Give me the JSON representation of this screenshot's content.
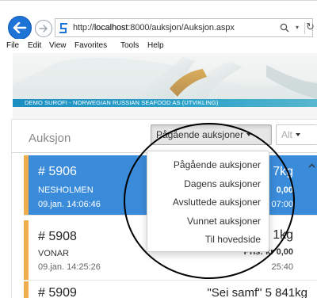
{
  "browser": {
    "url_prefix": "http://",
    "url_host": "localhost",
    "url_rest": ":8000/auksjon/Auksjon.aspx",
    "search_glyph": "⚲",
    "search_dropdown_glyph": "▾",
    "refresh_glyph": "↻"
  },
  "menu": {
    "file": "File",
    "edit": "Edit",
    "view": "View",
    "favorites": "Favorites",
    "tools": "Tools",
    "help": "Help"
  },
  "banner": {
    "text": "DEMO SUROFI - NORWEGIAN RUSSIAN SEAFOOD AS (UTVIKLING)"
  },
  "panel": {
    "title": "Auksjon",
    "filter_button": "Pågående auksjoner",
    "other_button": "Alt"
  },
  "dropdown": {
    "items": [
      "Pågående auksjoner",
      "Dagens auksjoner",
      "Avsluttede auksjoner",
      "Vunnet auksjoner",
      "Til hovedside"
    ]
  },
  "auctions": [
    {
      "number": "# 5906",
      "vessel": "NESHOLMEN",
      "timestamp": "09.jan. 14:06:46",
      "weight": "7kg",
      "price": "0,00",
      "time_left": "07:00"
    },
    {
      "number": "# 5908",
      "vessel": "VONAR",
      "timestamp": "09.jan. 14:25:26",
      "weight": "1kg",
      "price": "Pris: kr 0,00",
      "time_left": "25:40"
    },
    {
      "number": "# 5909",
      "product": "\"Sei samf\" 5 841kg"
    }
  ],
  "colors": {
    "accent_blue": "#3a8bd9",
    "status_orange": "#f0ad4e",
    "banner_strip": "#1b8ec2"
  }
}
